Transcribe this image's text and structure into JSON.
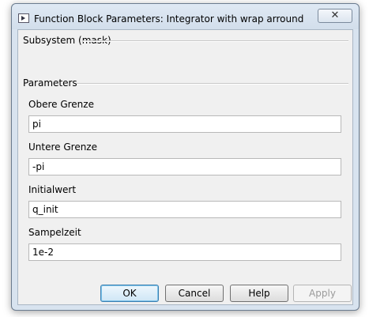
{
  "window": {
    "title": "Function Block Parameters: Integrator with wrap arround",
    "close_glyph": "✕"
  },
  "description": {
    "title": "Subsystem (mask)"
  },
  "parameters": {
    "title": "Parameters",
    "fields": [
      {
        "label": "Obere Grenze",
        "value": "pi"
      },
      {
        "label": "Untere Grenze",
        "value": "-pi"
      },
      {
        "label": "Initialwert",
        "value": "q_init"
      },
      {
        "label": "Sampelzeit",
        "value": "1e-2"
      }
    ]
  },
  "buttons": {
    "ok": "OK",
    "cancel": "Cancel",
    "help": "Help",
    "apply": "Apply"
  }
}
